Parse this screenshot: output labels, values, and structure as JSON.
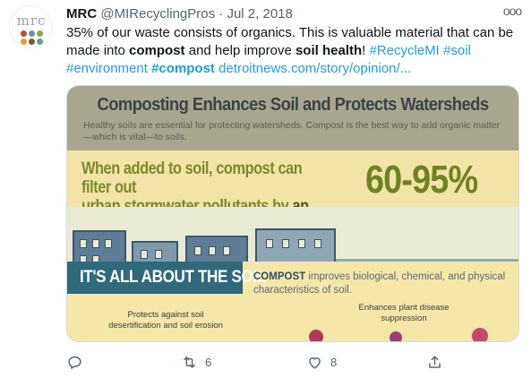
{
  "tweet": {
    "author_name": "MRC",
    "handle": "@MIRecyclingPros",
    "separator": "·",
    "date": "Jul 2, 2018",
    "more_label": "ooo",
    "avatar_text": "mrc",
    "text": {
      "p1": "35% of our waste consists of organics. This is valuable material that can be made into ",
      "w_compost": "compost",
      "p2": " and help improve ",
      "w_soil_health": "soil health",
      "p3": "! ",
      "tag_recycle": "#RecycleMI",
      "tag_soil": "#soil",
      "tag_environment": "#environment",
      "tag_compost": "#compost",
      "url": "detroitnews.com/story/opinion/..."
    }
  },
  "media": {
    "title": "Composting Enhances Soil and Protects Watersheds",
    "subtitle": "Healthy soils are essential for protecting watersheds. Compost is the best way to add organic matter—which is vital—to soils.",
    "lead_line1": "When added to soil, compost can filter out",
    "lead_line2": "urban stormwater pollutants by ",
    "lead_emph": "an astounding",
    "percent": "60-95%",
    "banner": "IT'S ALL ABOUT THE SOIL",
    "compost_word": "COMPOST",
    "compost_text": " improves biological, chemical, and physical characteristics of soil.",
    "protects": "Protects against soil desertification and soil erosion",
    "enhances": "Enhances plant disease suppression"
  },
  "actions": {
    "reply_count": "",
    "retweet_count": "6",
    "like_count": "8",
    "share_count": ""
  },
  "colors": {
    "link": "#1d9bf0",
    "muted": "#536471",
    "text": "#0f1419"
  },
  "icons": [
    "reply-icon",
    "retweet-icon",
    "like-icon",
    "share-icon",
    "more-icon"
  ]
}
